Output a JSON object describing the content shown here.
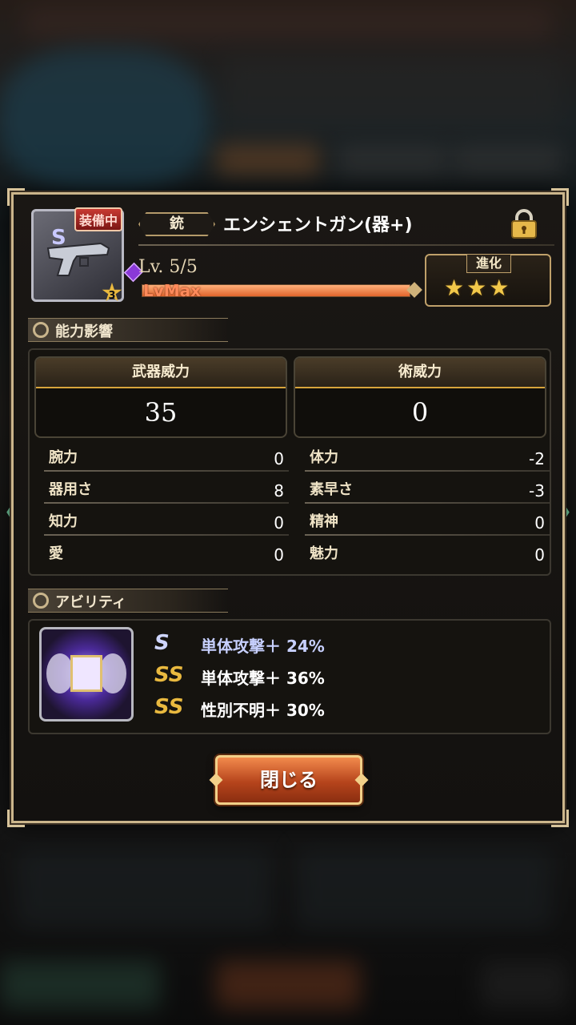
{
  "item": {
    "equip_badge": "装備中",
    "level_star": "3",
    "type": "銃",
    "name": "エンシェントガン(器+)",
    "level": "Lv. 5/5",
    "exp_label": "LvMax",
    "exp_fill": 1.0,
    "evolve_label": "進化",
    "evolve_stars": "★★★",
    "evolve_star_count": 3
  },
  "sections": {
    "ability_influence": "能力影響",
    "ability": "アビリティ"
  },
  "power": {
    "weapon_label": "武器威力",
    "weapon_value": "35",
    "magic_label": "術威力",
    "magic_value": "0"
  },
  "stats": {
    "left": [
      {
        "label": "腕力",
        "value": "0"
      },
      {
        "label": "器用さ",
        "value": "8"
      },
      {
        "label": "知力",
        "value": "0"
      },
      {
        "label": "愛",
        "value": "0"
      }
    ],
    "right": [
      {
        "label": "体力",
        "value": "-2"
      },
      {
        "label": "素早さ",
        "value": "-3"
      },
      {
        "label": "精神",
        "value": "0"
      },
      {
        "label": "魅力",
        "value": "0"
      }
    ]
  },
  "abilities": [
    {
      "icon": "S",
      "tier": "silver",
      "text": "単体攻撃＋ 24%"
    },
    {
      "icon": "SS",
      "tier": "gold",
      "text": "単体攻撃＋ 36%"
    },
    {
      "icon": "SS",
      "tier": "gold",
      "text": "性別不明＋ 30%"
    }
  ],
  "buttons": {
    "close": "閉じる"
  },
  "colors": {
    "frame": "#cbb58b",
    "accent_orange": "#e0642c",
    "star_gold": "#f2c84a"
  }
}
